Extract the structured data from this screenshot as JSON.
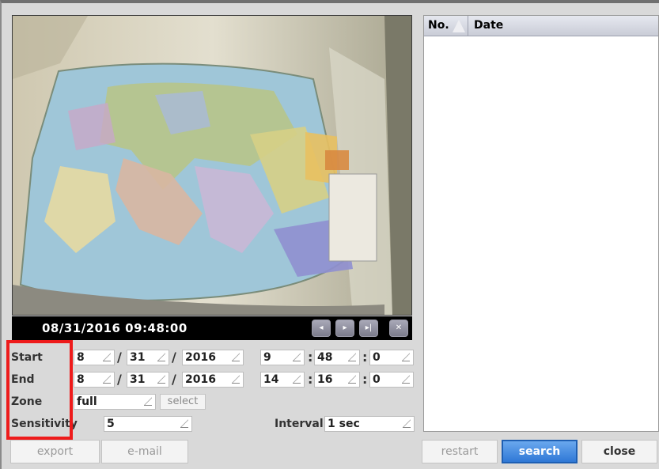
{
  "video": {
    "timestamp": "08/31/2016  09:48:00",
    "controls": [
      {
        "name": "prev-frame",
        "glyph": "◂"
      },
      {
        "name": "play",
        "glyph": "▸"
      },
      {
        "name": "next-frame",
        "glyph": "▸|"
      },
      {
        "name": "close-video",
        "glyph": "✕"
      }
    ]
  },
  "list": {
    "col_no": "No.",
    "col_date": "Date",
    "rows": []
  },
  "form": {
    "start_label": "Start",
    "end_label": "End",
    "zone_label": "Zone",
    "sensitivity_label": "Sensitivity",
    "interval_label": "Interval",
    "start": {
      "month": "8",
      "day": "31",
      "year": "2016",
      "hour": "9",
      "minute": "48",
      "second": "0"
    },
    "end": {
      "month": "8",
      "day": "31",
      "year": "2016",
      "hour": "14",
      "minute": "16",
      "second": "0"
    },
    "date_sep": "/",
    "time_sep": ":",
    "zone_value": "full",
    "select_label": "select",
    "sensitivity_value": "5",
    "interval_value": "1 sec"
  },
  "buttons": {
    "export": "export",
    "email": "e-mail",
    "restart": "restart",
    "search": "search",
    "close": "close"
  },
  "colors": {
    "highlight_box": "#ee1b1b",
    "search_button": "#2f78d6"
  }
}
